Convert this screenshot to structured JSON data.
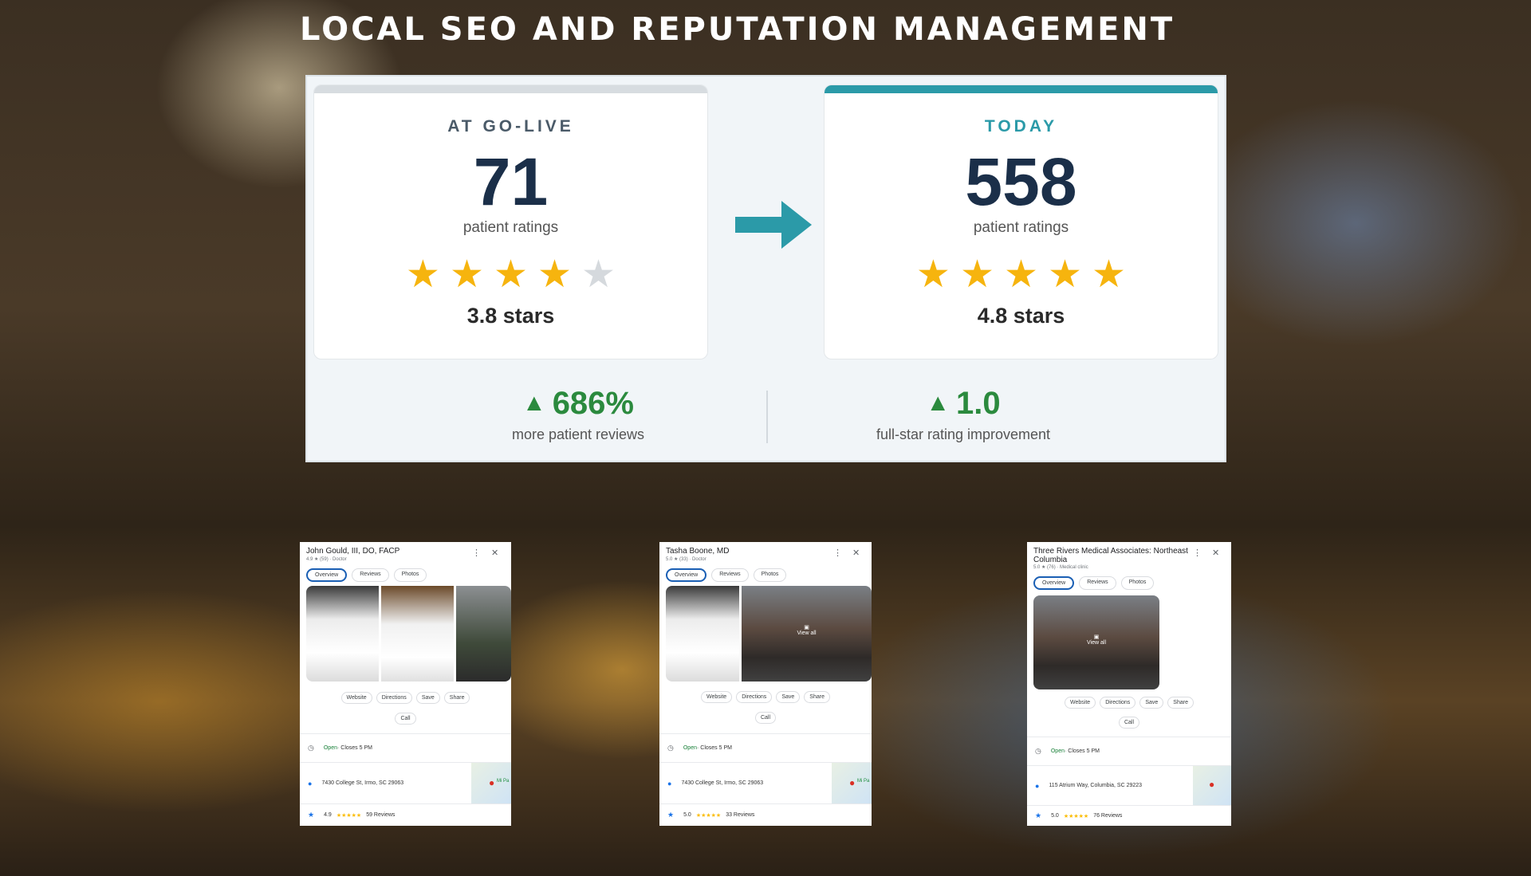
{
  "headline": "LOCAL SEO AND REPUTATION MANAGEMENT",
  "colors": {
    "teal": "#2b9aa8",
    "gray_bar": "#d7dce0",
    "navy": "#1b2f49",
    "green": "#2b8a3e",
    "star_on": "#f6b40e",
    "star_off": "#d5d9dd"
  },
  "before": {
    "label": "AT GO-LIVE",
    "count": "71",
    "count_label": "patient ratings",
    "rating": "3.8 stars",
    "filled_stars": 4
  },
  "after": {
    "label": "TODAY",
    "count": "558",
    "count_label": "patient ratings",
    "rating": "4.8 stars",
    "filled_stars": 5
  },
  "stats": [
    {
      "value": "686%",
      "desc": "more patient reviews"
    },
    {
      "value": "1.0",
      "desc": "full-star rating improvement"
    }
  ],
  "listings": [
    {
      "name": "John Gould, III, DO, FACP",
      "meta": "4.9 ★ (59) · Doctor",
      "tabs": [
        "Overview",
        "Reviews",
        "Photos"
      ],
      "actions": [
        "Website",
        "Directions",
        "Save",
        "Share"
      ],
      "call": "Call",
      "hours_status": "Open",
      "hours_rest": " · Closes 5 PM",
      "address": "7430 College St, Irmo, SC 29063",
      "rating": "4.9",
      "reviews": "59 Reviews",
      "map_label": "Mi Pa"
    },
    {
      "name": "Tasha Boone, MD",
      "meta": "5.0 ★ (33) · Doctor",
      "tabs": [
        "Overview",
        "Reviews",
        "Photos"
      ],
      "actions": [
        "Website",
        "Directions",
        "Save",
        "Share"
      ],
      "call": "Call",
      "view_all": "View all",
      "hours_status": "Open",
      "hours_rest": " · Closes 5 PM",
      "address": "7430 College St, Irmo, SC 29063",
      "rating": "5.0",
      "reviews": "33 Reviews",
      "map_label": "Mi Pa"
    },
    {
      "name": "Three Rivers Medical Associates: Northeast Columbia",
      "meta": "5.0 ★ (76) · Medical clinic",
      "tabs": [
        "Overview",
        "Reviews",
        "Photos"
      ],
      "actions": [
        "Website",
        "Directions",
        "Save",
        "Share"
      ],
      "call": "Call",
      "view_all": "View all",
      "hours_status": "Open",
      "hours_rest": " · Closes 5 PM",
      "address": "115 Atrium Way, Columbia, SC 29223",
      "rating": "5.0",
      "reviews": "76 Reviews"
    }
  ]
}
